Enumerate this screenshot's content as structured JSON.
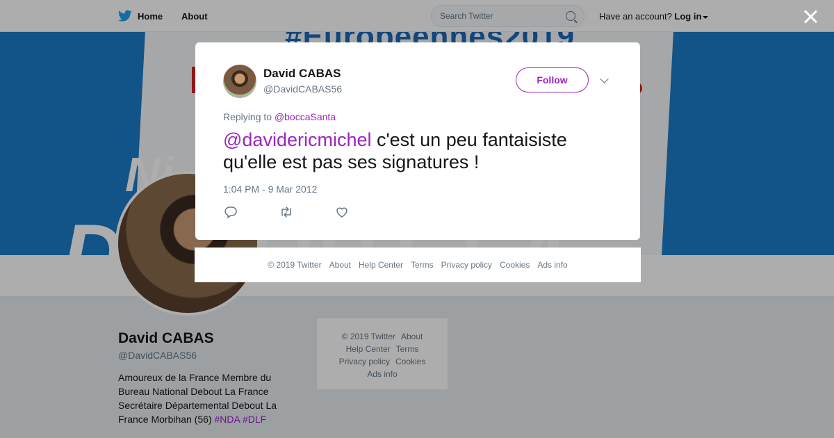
{
  "header": {
    "home_label": "Home",
    "about_label": "About",
    "search_placeholder": "Search Twitter",
    "account_prompt": "Have an account?",
    "login_label": "Log in"
  },
  "banner": {
    "hashtag": "#Européennes2019",
    "big_text": "DEBOUT LA FRANCE !",
    "ni_text": "Ni"
  },
  "profile": {
    "name": "David CABAS",
    "handle": "@DavidCABAS56",
    "bio": "Amoureux de la France Membre du Bureau National Debout La France Secrétaire Départemental Debout La France Morbihan (56) ",
    "bio_tags": [
      "#NDA",
      "#DLF"
    ]
  },
  "sidebar_footer": {
    "copyright": "© 2019 Twitter",
    "about": "About",
    "help": "Help Center",
    "terms": "Terms",
    "privacy": "Privacy policy",
    "cookies": "Cookies",
    "ads": "Ads info"
  },
  "tweet": {
    "author_name": "David CABAS",
    "author_handle": "@DavidCABAS56",
    "follow_label": "Follow",
    "replying_prefix": "Replying to",
    "replying_to": "@boccaSanta",
    "mention": "@davidericmichel",
    "text": " c'est un peu fantaisiste qu'elle est pas ses signatures !",
    "timestamp": "1:04 PM - 9 Mar 2012"
  },
  "modal_footer": {
    "copyright": "© 2019 Twitter",
    "about": "About",
    "help": "Help Center",
    "terms": "Terms",
    "privacy": "Privacy policy",
    "cookies": "Cookies",
    "ads": "Ads info"
  },
  "colors": {
    "accent": "#9a26bf",
    "banner_blue": "#1b7cc9",
    "twitter_blue": "#1da1f2"
  }
}
